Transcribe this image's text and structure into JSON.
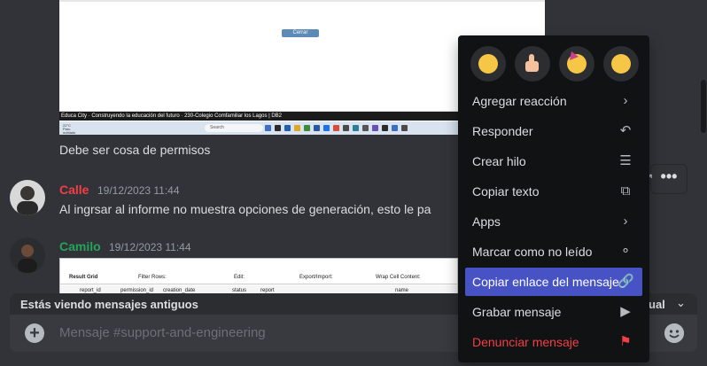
{
  "messages": {
    "screenshot1": {
      "close_button": "Cerrar",
      "footer_text": "Educa City · Construyendo la educación del futuro · 230-Colegio Comfamiliar los Lagos | DB2",
      "taskbar_search": "Search",
      "weather": "22°C Parc. nublado"
    },
    "line1": "Debe ser cosa de permisos",
    "msg2": {
      "author": "Calle",
      "author_color": "#f23f43",
      "timestamp": "19/12/2023 11:44",
      "text": "Al ingrsar al informe no muestra opciones de generación, esto le pa"
    },
    "msg3": {
      "author": "Camilo",
      "author_color": "#23a55a",
      "timestamp": "19/12/2023 11:44",
      "screenshot2": {
        "result_grid": "Result Grid",
        "filter_rows": "Filter Rows:",
        "edit": "Edit:",
        "export_import": "Export/Import:",
        "wrap_cell": "Wrap Cell Content:",
        "col_report_id": "report_id",
        "col_permission_id": "permission_id",
        "col_creation_date": "creation_date",
        "col_status": "status",
        "col_report": "report",
        "col_name": "name"
      }
    }
  },
  "banner": {
    "label": "Estás viendo mensajes antiguos",
    "jump": "ual"
  },
  "composer": {
    "placeholder": "Mensaje #support-and-engineering"
  },
  "context_menu": {
    "reactions": [
      "rofl-emoji",
      "thumbs-up-emoji",
      "party-face-emoji",
      "shushing-face-emoji"
    ],
    "items": [
      {
        "label": "Agregar reacción",
        "icon": "chevron-right-icon"
      },
      {
        "label": "Responder",
        "icon": "reply-icon"
      },
      {
        "label": "Crear hilo",
        "icon": "thread-icon"
      },
      {
        "label": "Copiar texto",
        "icon": "copy-icon"
      },
      {
        "label": "Apps",
        "icon": "chevron-right-icon"
      },
      {
        "label": "Marcar como no leído",
        "icon": "mark-unread-icon"
      },
      {
        "label": "Copiar enlace del mensaje",
        "icon": "link-icon"
      },
      {
        "label": "Grabar mensaje",
        "icon": "speaker-icon"
      },
      {
        "label": "Denunciar mensaje",
        "icon": "flag-icon"
      }
    ]
  },
  "colors": {
    "background": "#313338",
    "menu_bg": "#111214",
    "menu_active": "#4752c4",
    "danger": "#f23f43"
  }
}
